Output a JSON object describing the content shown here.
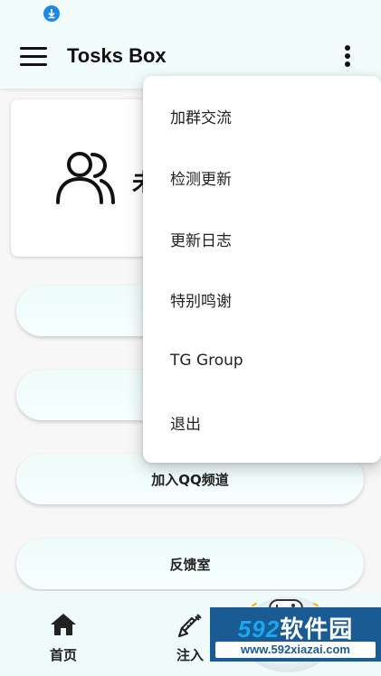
{
  "app": {
    "title": "Tosks Box"
  },
  "user_card": {
    "name_text": "未"
  },
  "buttons": [
    {
      "label": ""
    },
    {
      "label": ""
    },
    {
      "label": "加入QQ频道"
    },
    {
      "label": "反馈室"
    }
  ],
  "bottom_nav": {
    "items": [
      {
        "label": "首页",
        "icon": "home-icon"
      },
      {
        "label": "注入",
        "icon": "syringe-icon"
      }
    ]
  },
  "dropdown_menu": {
    "items": [
      {
        "label": "加群交流"
      },
      {
        "label": "检测更新"
      },
      {
        "label": "更新日志"
      },
      {
        "label": "特别鸣谢"
      },
      {
        "label": "TG Group"
      },
      {
        "label": "退出"
      }
    ]
  },
  "watermark": {
    "brand_number": "592",
    "brand_text": "软件园",
    "url": "www.592xiazai.com"
  },
  "colors": {
    "app_bar_bg": "#f1fcfb",
    "button_bg": "#eefcf9",
    "watermark_bg": "#1a5b93"
  }
}
